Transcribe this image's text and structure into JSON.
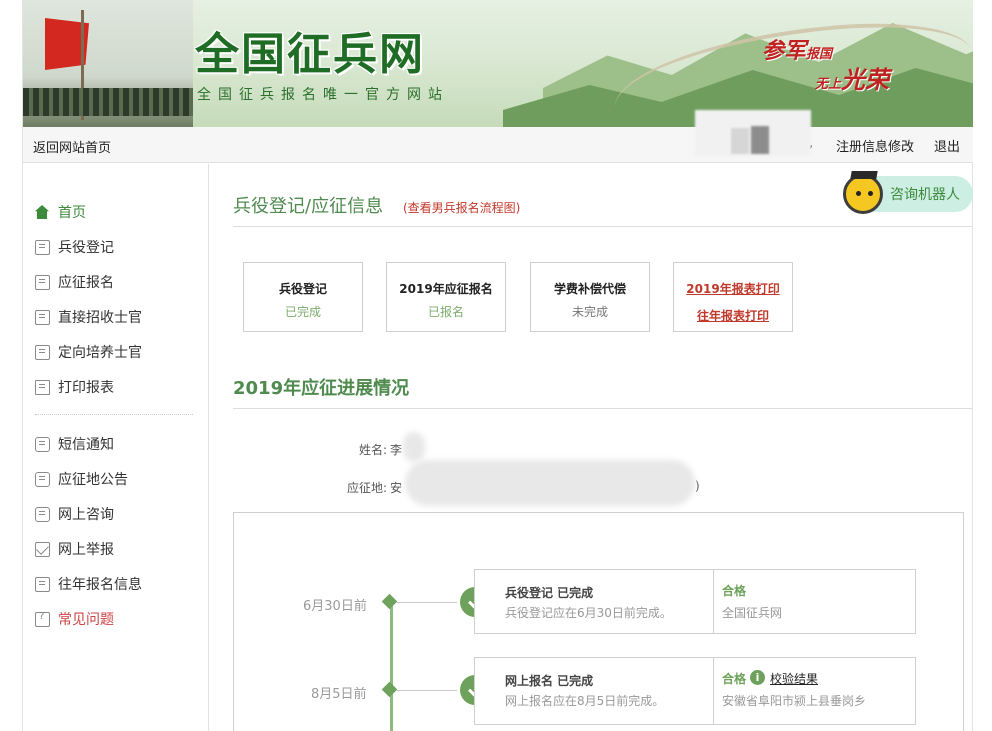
{
  "banner": {
    "title": "全国征兵网",
    "subtitle": "全国征兵报名唯一官方网站",
    "slogan_a": "参军",
    "slogan_a_small": "报国",
    "slogan_b_small": "无上",
    "slogan_b": "光荣"
  },
  "topbar": {
    "back": "返回网站首页",
    "comma": ",",
    "edit": "注册信息修改",
    "logout": "退出"
  },
  "sidebar": {
    "items": [
      {
        "label": "首页",
        "icon": "home-icon"
      },
      {
        "label": "兵役登记",
        "icon": "document-icon"
      },
      {
        "label": "应征报名",
        "icon": "document-icon"
      },
      {
        "label": "直接招收士官",
        "icon": "id-card-icon"
      },
      {
        "label": "定向培养士官",
        "icon": "id-card-icon"
      },
      {
        "label": "打印报表",
        "icon": "printer-icon"
      },
      {
        "label": "短信通知",
        "icon": "chat-icon"
      },
      {
        "label": "应征地公告",
        "icon": "chat-icon"
      },
      {
        "label": "网上咨询",
        "icon": "chat-icon"
      },
      {
        "label": "网上举报",
        "icon": "mail-icon"
      },
      {
        "label": "往年报名信息",
        "icon": "history-icon"
      },
      {
        "label": "常见问题",
        "icon": "question-icon"
      }
    ]
  },
  "main": {
    "title": "兵役登记/应征信息",
    "flow_link": "(查看男兵报名流程图)",
    "robot": "咨询机器人",
    "cards": [
      {
        "title": "兵役登记",
        "status": "已完成"
      },
      {
        "title": "2019年应征报名",
        "status": "已报名"
      },
      {
        "title": "学费补偿代偿",
        "status": "未完成"
      }
    ],
    "print_links": {
      "current": "2019年报表打印",
      "past": "往年报表打印"
    },
    "progress_title": "2019年应征进展情况",
    "name_label": "姓名:",
    "name_value": "李",
    "place_label": "应征地:",
    "place_value": "安",
    "place_tail": ")",
    "timeline": [
      {
        "date": "6月30日前",
        "title": "兵役登记 已完成",
        "desc": "兵役登记应在6月30日前完成。",
        "result": "合格",
        "result_sub": "全国征兵网"
      },
      {
        "date": "8月5日前",
        "title": "网上报名 已完成",
        "desc": "网上报名应在8月5日前完成。",
        "result": "合格",
        "info": "i",
        "verify": "校验结果",
        "result_sub": "安徽省阜阳市颍上县垂岗乡"
      }
    ]
  },
  "colors": {
    "accent_green": "#4f8a4f",
    "link_red": "#c0392b",
    "check_green": "#6ea25c"
  }
}
